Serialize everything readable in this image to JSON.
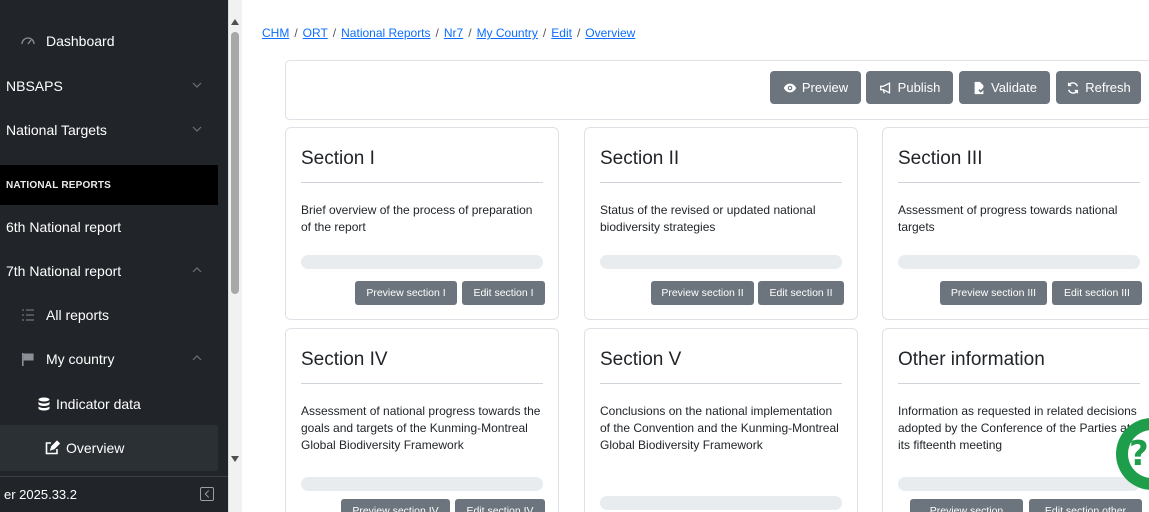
{
  "breadcrumb": {
    "items": [
      "CHM",
      "ORT",
      "National Reports",
      "Nr7",
      "My Country",
      "Edit",
      "Overview"
    ],
    "separator": "/"
  },
  "sidebar": {
    "dashboard": {
      "label": "Dashboard",
      "icon": "dashboard-gauge-icon"
    },
    "nbsaps": {
      "label": "NBSAPS",
      "icon": "chevron-down-icon"
    },
    "national_targets": {
      "label": "National Targets",
      "icon": "chevron-down-icon"
    },
    "section_header": "NATIONAL REPORTS",
    "sixth_report": {
      "label": "6th National report"
    },
    "seventh_report": {
      "label": "7th National report",
      "icon": "chevron-up-icon"
    },
    "all_reports": {
      "label": "All reports",
      "icon": "list-icon"
    },
    "my_country": {
      "label": "My country",
      "icon": "flag-icon"
    },
    "indicator_data": {
      "label": "Indicator data",
      "icon": "database-icon"
    },
    "overview": {
      "label": "Overview",
      "icon": "edit-icon"
    },
    "version": "er 2025.33.2"
  },
  "toolbar": {
    "preview_label": "Preview",
    "publish_label": "Publish",
    "validate_label": "Validate",
    "refresh_label": "Refresh"
  },
  "sections": [
    {
      "title": "Section I",
      "description": "Brief overview of the process of preparation of the report",
      "preview_label": "Preview section I",
      "edit_label": "Edit section I"
    },
    {
      "title": "Section II",
      "description": "Status of the revised or updated national biodiversity strategies",
      "preview_label": "Preview section II",
      "edit_label": "Edit section II"
    },
    {
      "title": "Section III",
      "description": "Assessment of progress towards national targets",
      "preview_label": "Preview section III",
      "edit_label": "Edit section III"
    },
    {
      "title": "Section IV",
      "description": "Assessment of national progress towards the goals and targets of the Kunming-Montreal Global Biodiversity Framework",
      "preview_label": "Preview section IV",
      "edit_label": "Edit section IV"
    },
    {
      "title": "Section V",
      "description": "Conclusions on the national implementation of the Convention and the Kunming-Montreal Global Biodiversity Framework",
      "preview_label": "",
      "edit_label": ""
    },
    {
      "title": "Other information",
      "description": "Information as requested in related decisions adopted by the Conference of the Parties at its fifteenth meeting",
      "preview_label": "Preview section",
      "edit_label": "Edit section other"
    }
  ],
  "colors": {
    "sidebar_bg": "#212529",
    "button_gray": "#6c757d",
    "link_blue": "#0d6efd",
    "chat_green": "#1e9e4a"
  }
}
